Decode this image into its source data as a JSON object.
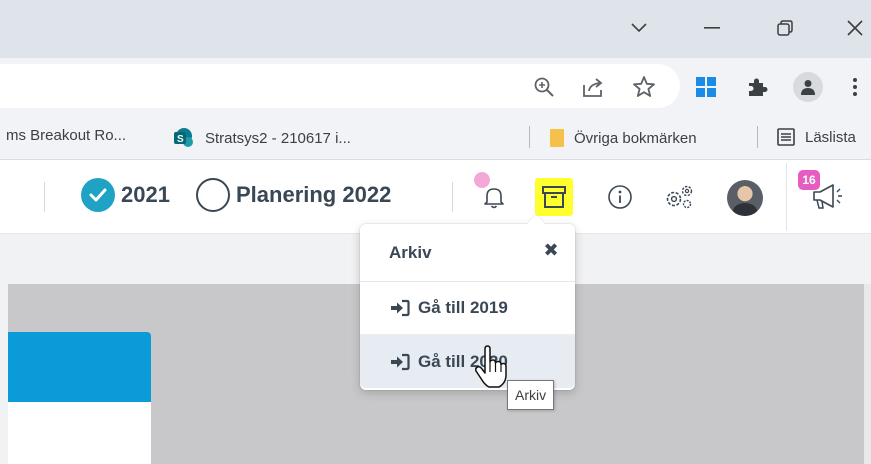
{
  "window": {
    "controls": {
      "tab_search_icon": "chevron-down-icon",
      "minimize_icon": "minimize-icon",
      "restore_icon": "restore-icon",
      "close_icon": "close-icon"
    }
  },
  "toolbar": {
    "icons": [
      "zoom-icon",
      "share-icon",
      "star-icon",
      "windows-icon",
      "extensions-icon",
      "profile-icon",
      "menu-icon"
    ]
  },
  "bookmarks": {
    "items": [
      {
        "label": "ms Breakout Ro...",
        "icon": "none"
      },
      {
        "label": "Stratsys2 - 210617 i...",
        "icon": "sharepoint-icon"
      }
    ],
    "other_folder": {
      "label": "Övriga bokmärken",
      "icon": "folder-icon"
    },
    "reading_list": {
      "label": "Läslista",
      "icon": "reading-list-icon"
    }
  },
  "app": {
    "periods": [
      {
        "label": "2021",
        "state": "selected"
      },
      {
        "label": "Planering 2022",
        "state": "unselected"
      }
    ],
    "badge_count": "16",
    "colors": {
      "check": "#1fa2c4",
      "text": "#3a4755",
      "highlight": "#ffff2e",
      "badge": "#e65cc0",
      "notification_dot": "#f5a8d8",
      "banner": "#0c9bd9"
    }
  },
  "archive_popover": {
    "title": "Arkiv",
    "close_symbol": "✖",
    "items": [
      {
        "label": "Gå till 2019"
      },
      {
        "label": "Gå till 2020"
      }
    ]
  },
  "tooltip": {
    "text": "Arkiv"
  }
}
